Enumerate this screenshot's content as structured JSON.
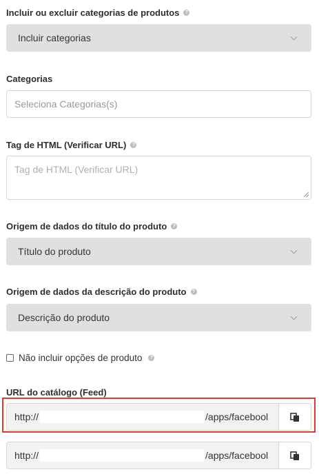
{
  "fields": {
    "include_exclude": {
      "label": "Incluir ou excluir categorias de produtos",
      "value": "Incluir categorias"
    },
    "categories": {
      "label": "Categorias",
      "placeholder": "Seleciona Categorias(s)"
    },
    "html_tag": {
      "label": "Tag de HTML (Verificar URL)",
      "placeholder": "Tag de HTML (Verificar URL)"
    },
    "title_source": {
      "label": "Origem de dados do título do produto",
      "value": "Título do produto"
    },
    "description_source": {
      "label": "Origem de dados da descrição do produto",
      "value": "Descrição do produto"
    },
    "exclude_options": {
      "label": "Não incluir opções de produto",
      "checked": false
    },
    "catalog_url": {
      "label": "URL do catálogo (Feed)",
      "url1_prefix": "http://",
      "url1_suffix": "/apps/facebool",
      "url2_prefix": "http://",
      "url2_suffix": "/apps/facebool"
    }
  },
  "icons": {
    "help": "question-circle-icon",
    "copy": "clipboard-copy-icon",
    "chevron": "chevron-down-icon"
  },
  "colors": {
    "highlight": "#e23b2a",
    "select_bg": "#e0e0e0"
  }
}
